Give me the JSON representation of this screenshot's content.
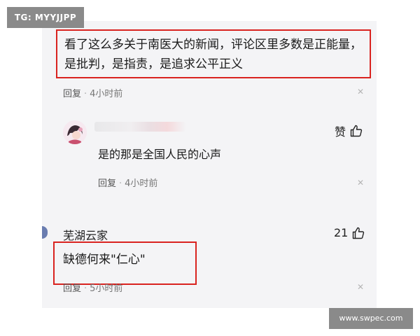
{
  "watermarks": {
    "top_left": "TG: MYYJJPP",
    "bottom_right": "www.swpec.com"
  },
  "colors": {
    "highlight": "#d9231f",
    "background": "#f4f4f6"
  },
  "comments": [
    {
      "text_line1": "看了这么多关于南医大的新闻，评论区里多数是正能量，",
      "text_line2": "是批判，是指责，是追求公平正义",
      "reply_label": "回复",
      "separator": "·",
      "time": "4小时前",
      "highlighted": true
    },
    {
      "author": "",
      "text": "是的那是全国人民的心声",
      "like_label": "赞",
      "reply_label": "回复",
      "separator": "·",
      "time": "4小时前",
      "is_reply": true
    },
    {
      "author": "芜湖云家",
      "text": "缺德何来\"仁心\"",
      "like_count": "21",
      "reply_label": "回复",
      "separator": "·",
      "time": "5小时前",
      "highlighted": true
    }
  ],
  "icons": {
    "like": "thumbs-up-icon",
    "close": "close-icon"
  }
}
